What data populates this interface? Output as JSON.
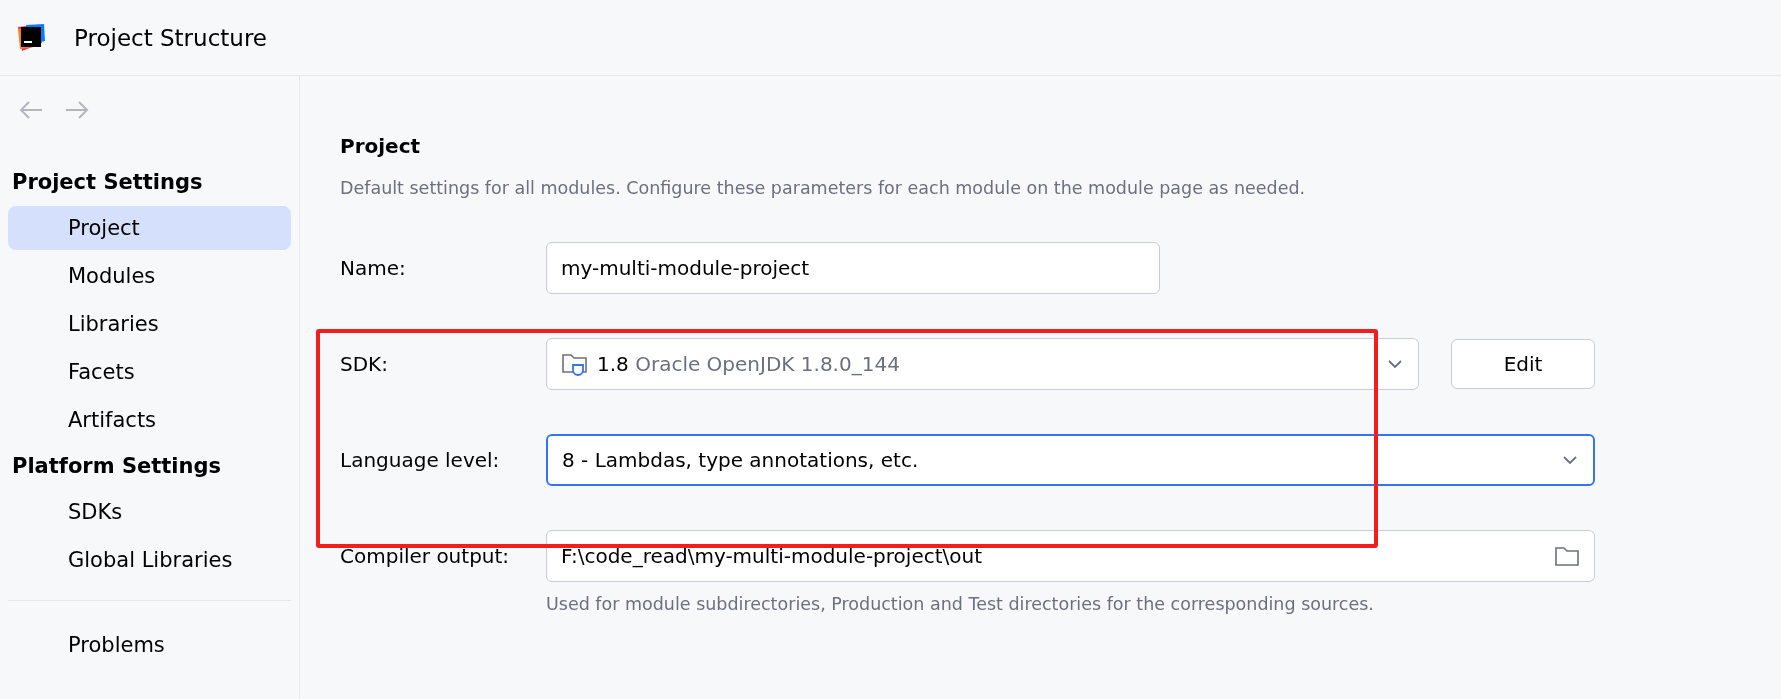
{
  "window": {
    "title": "Project Structure"
  },
  "sidebar": {
    "sections": [
      {
        "title": "Project Settings",
        "items": [
          {
            "label": "Project",
            "selected": true
          },
          {
            "label": "Modules",
            "selected": false
          },
          {
            "label": "Libraries",
            "selected": false
          },
          {
            "label": "Facets",
            "selected": false
          },
          {
            "label": "Artifacts",
            "selected": false
          }
        ]
      },
      {
        "title": "Platform Settings",
        "items": [
          {
            "label": "SDKs",
            "selected": false
          },
          {
            "label": "Global Libraries",
            "selected": false
          }
        ]
      }
    ],
    "footer_items": [
      {
        "label": "Problems",
        "selected": false
      }
    ]
  },
  "panel": {
    "title": "Project",
    "description": "Default settings for all modules. Configure these parameters for each module on the module page as needed.",
    "fields": [
      {
        "kind": "text",
        "label": "Name:",
        "value": "my-multi-module-project"
      },
      {
        "kind": "sdk",
        "label": "SDK:",
        "version": "1.8",
        "detail": "Oracle OpenJDK 1.8.0_144",
        "button": "Edit"
      },
      {
        "kind": "combo",
        "label": "Language level:",
        "value": "8 - Lambdas, type annotations, etc.",
        "focused": true
      },
      {
        "kind": "path",
        "label": "Compiler output:",
        "value": "F:\\code_read\\my-multi-module-project\\out",
        "hint": "Used for module subdirectories, Production and Test directories for the corresponding sources."
      }
    ]
  }
}
